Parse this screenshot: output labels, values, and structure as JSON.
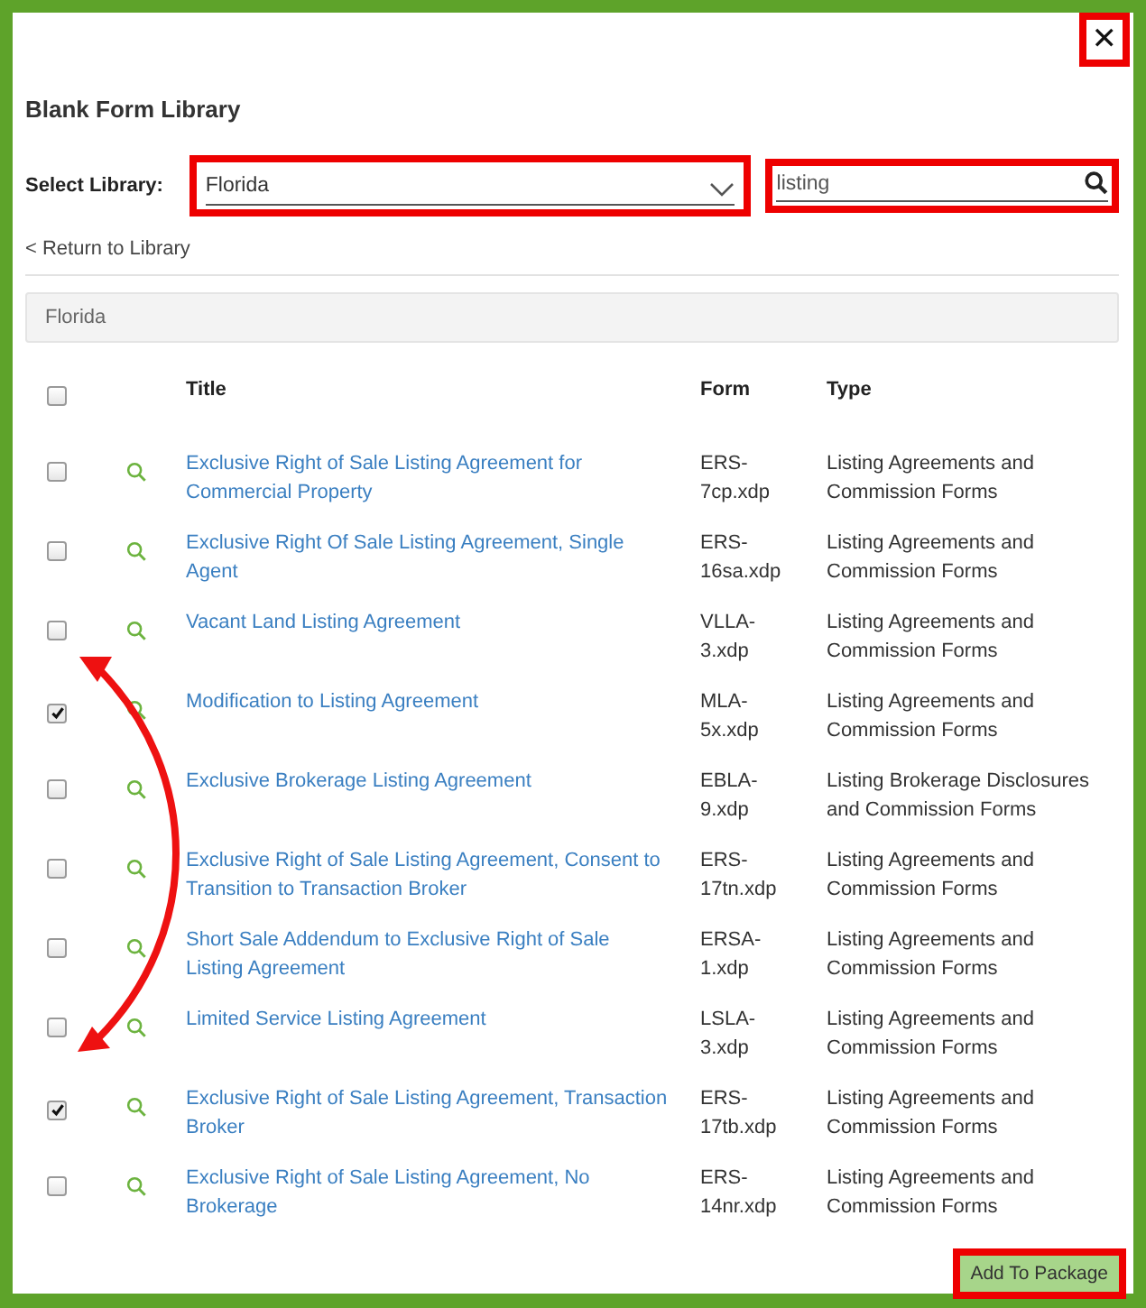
{
  "close_button": {
    "label": "✕",
    "annotated": true
  },
  "title": "Blank Form Library",
  "library": {
    "label": "Select Library:",
    "value": "Florida",
    "annotated": true
  },
  "search": {
    "value": "listing",
    "annotated": true
  },
  "back_link": "< Return to Library",
  "breadcrumb": "Florida",
  "table": {
    "select_all": {
      "checked": false
    },
    "columns": [
      "Title",
      "Form",
      "Type"
    ],
    "rows": [
      {
        "checked": false,
        "title": "Exclusive Right of Sale Listing Agreement for Commercial Property",
        "form": "ERS-7cp.xdp",
        "type": "Listing Agreements and Commission Forms"
      },
      {
        "checked": false,
        "title": "Exclusive Right Of Sale Listing Agreement, Single Agent",
        "form": "ERS-16sa.xdp",
        "type": "Listing Agreements and Commission Forms"
      },
      {
        "checked": false,
        "title": "Vacant Land Listing Agreement",
        "form": "VLLA-3.xdp",
        "type": "Listing Agreements and Commission Forms"
      },
      {
        "checked": true,
        "title": "Modification to Listing Agreement",
        "form": "MLA-5x.xdp",
        "type": "Listing Agreements and Commission Forms"
      },
      {
        "checked": false,
        "title": "Exclusive Brokerage Listing Agreement",
        "form": "EBLA-9.xdp",
        "type": "Listing Brokerage Disclosures and Commission Forms"
      },
      {
        "checked": false,
        "title": "Exclusive Right of Sale Listing Agreement, Consent to Transition to Transaction Broker",
        "form": "ERS-17tn.xdp",
        "type": "Listing Agreements and Commission Forms"
      },
      {
        "checked": false,
        "title": "Short Sale Addendum to Exclusive Right of Sale Listing Agreement",
        "form": "ERSA-1.xdp",
        "type": "Listing Agreements and Commission Forms"
      },
      {
        "checked": false,
        "title": "Limited Service Listing Agreement",
        "form": "LSLA-3.xdp",
        "type": "Listing Agreements and Commission Forms"
      },
      {
        "checked": true,
        "title": "Exclusive Right of Sale Listing Agreement, Transaction Broker",
        "form": "ERS-17tb.xdp",
        "type": "Listing Agreements and Commission Forms"
      },
      {
        "checked": false,
        "title": "Exclusive Right of Sale Listing Agreement, No Brokerage",
        "form": "ERS-14nr.xdp",
        "type": "Listing Agreements and Commission Forms"
      }
    ]
  },
  "add_button": {
    "label": "Add To Package",
    "annotated": true
  }
}
